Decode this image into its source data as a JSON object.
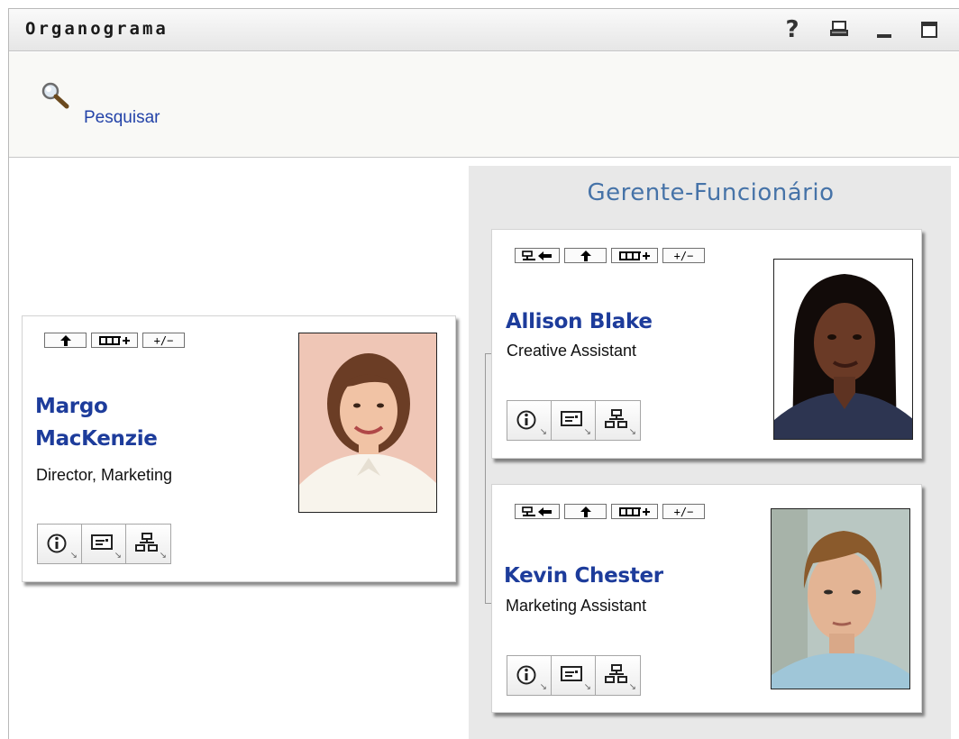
{
  "window": {
    "title": "Organograma",
    "help_label": "?"
  },
  "search": {
    "label": "Pesquisar"
  },
  "group": {
    "title": "Gerente-Funcionário"
  },
  "card_actions": {
    "plus_minus": "+/−"
  },
  "root": {
    "name_line1": "Margo",
    "name_line2": "MacKenzie",
    "role": "Director, Marketing"
  },
  "reports": [
    {
      "name": "Allison Blake",
      "role": "Creative Assistant"
    },
    {
      "name": "Kevin Chester",
      "role": "Marketing Assistant"
    }
  ],
  "colors": {
    "link": "#1d3c9b",
    "group_title": "#4673a8",
    "group_bg": "#e8e8e8"
  }
}
